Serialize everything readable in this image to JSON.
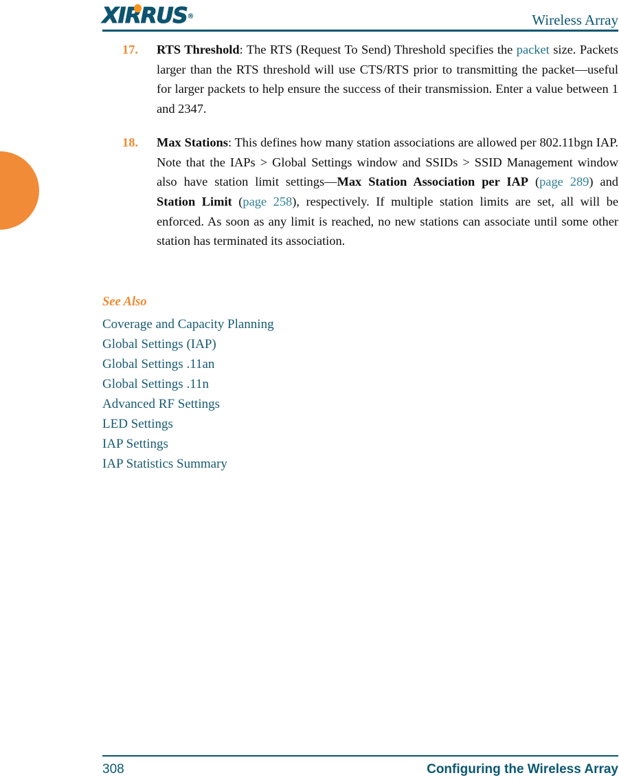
{
  "header": {
    "logo_text": "XIRRUS",
    "logo_trademark": "®",
    "title": "Wireless Array"
  },
  "steps": [
    {
      "number": "17.",
      "term": "RTS Threshold",
      "text_1": ": The RTS (Request To Send) Threshold specifies the ",
      "link_1": "packet",
      "text_2": " size. Packets larger than the RTS threshold will use CTS/RTS prior to transmitting the packet—useful for larger packets to help ensure the success of their transmission. Enter a value between 1 and 2347."
    },
    {
      "number": "18.",
      "term": "Max Stations",
      "text_1": ": This defines how many station associations are allowed per 802.11bgn IAP. Note that the IAPs > Global Settings window and SSIDs > SSID Management window also have station limit settings—",
      "term_2": "Max Station Association per IAP",
      "text_2": " (",
      "link_1": "page 289",
      "text_3": ") and ",
      "term_3": "Station Limit",
      "text_4": " (",
      "link_2": "page 258",
      "text_5": "), respectively. If multiple station limits are set, all will be enforced. As soon as any limit is reached, no new stations can associate until some other station has terminated its association."
    }
  ],
  "see_also": {
    "title": "See Also",
    "items": [
      "Coverage and Capacity Planning",
      "Global Settings (IAP)",
      "Global Settings .11an",
      "Global Settings .11n",
      "Advanced RF Settings",
      "LED Settings",
      "IAP Settings",
      "IAP Statistics Summary"
    ]
  },
  "footer": {
    "page_number": "308",
    "chapter": "Configuring the Wireless Array"
  },
  "colors": {
    "teal": "#0b5772",
    "orange": "#f0892f",
    "link": "#1b6e86",
    "tab_orange": "#f28b38"
  }
}
